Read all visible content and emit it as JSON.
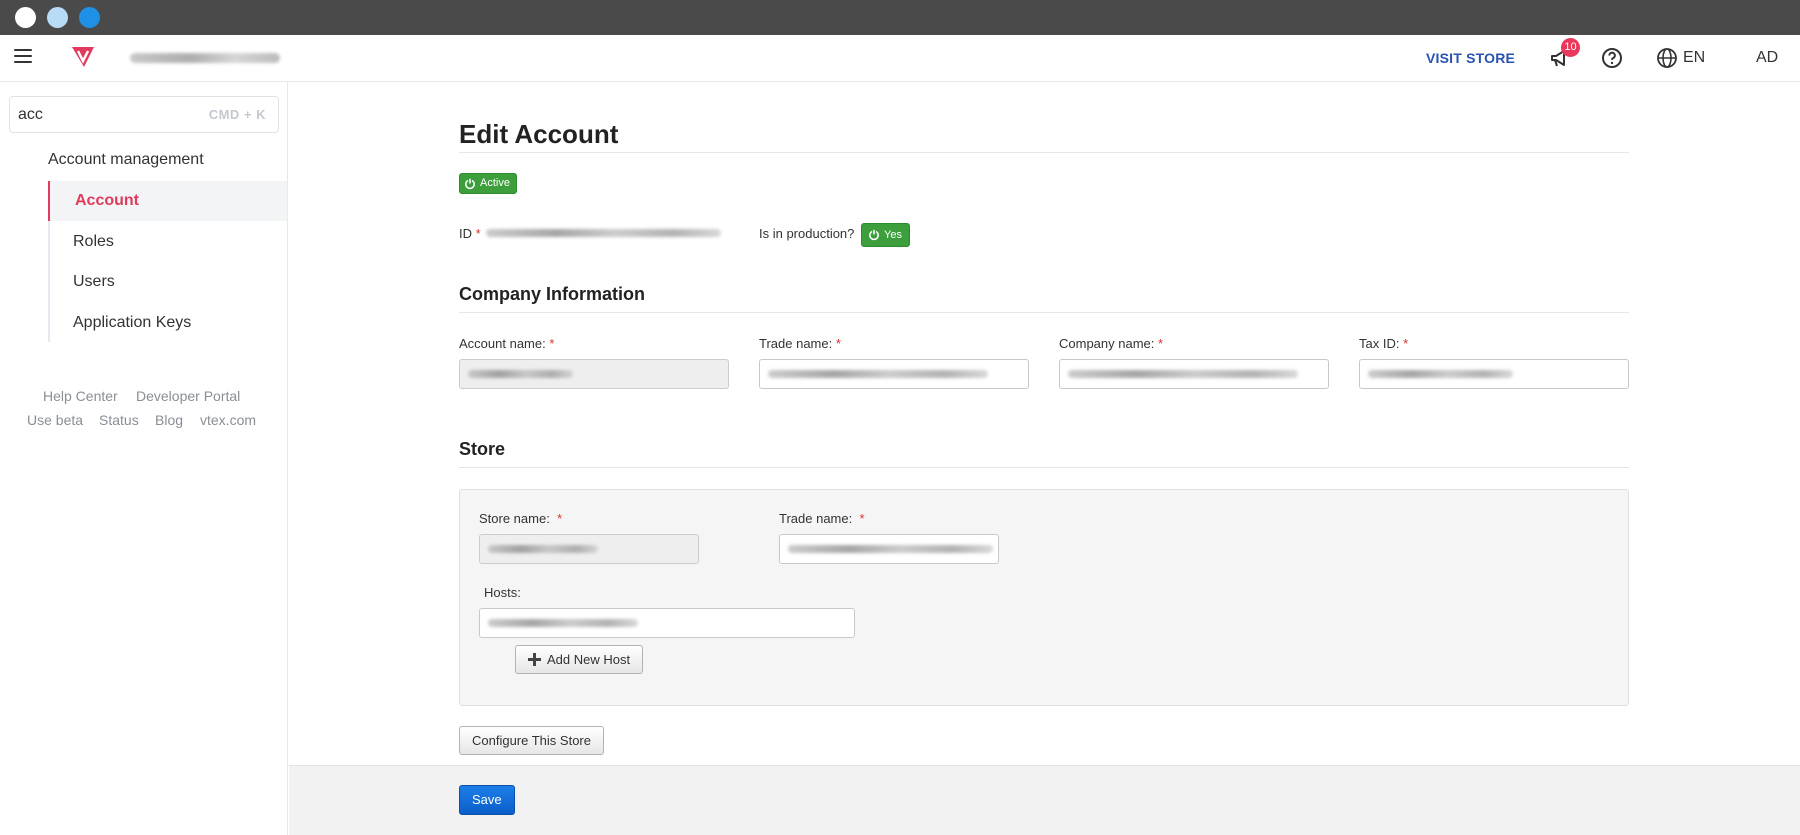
{
  "window": {
    "controls": [
      "close",
      "minimize",
      "zoom"
    ]
  },
  "header": {
    "visit_store": "VISIT STORE",
    "notifications_count": "10",
    "language": "EN",
    "avatar": "AD",
    "colors": {
      "accent": "#2953b2",
      "badge": "#e9385a"
    }
  },
  "sidebar": {
    "search": {
      "value": "acc",
      "shortcut": "CMD + K"
    },
    "group_label": "Account management",
    "items": [
      {
        "label": "Account",
        "active": true
      },
      {
        "label": "Roles"
      },
      {
        "label": "Users"
      },
      {
        "label": "Application Keys"
      }
    ],
    "footer_links": [
      "Help Center",
      "Developer Portal",
      "Use beta",
      "Status",
      "Blog",
      "vtex.com"
    ],
    "colors": {
      "active": "#e13a5c"
    }
  },
  "page": {
    "title": "Edit Account",
    "status_button": "Active",
    "id_label": "ID",
    "required_mark": "*",
    "production_label": "Is in production?",
    "production_button": "Yes"
  },
  "company": {
    "title": "Company Information",
    "account_name_label": "Account name:",
    "trade_name_label": "Trade name:",
    "company_name_label": "Company name:",
    "tax_id_label": "Tax ID:"
  },
  "store": {
    "title": "Store",
    "store_name_label": "Store name:",
    "trade_name_label": "Trade name:",
    "hosts_label": "Hosts:",
    "add_host_button": "Add New Host",
    "configure_button": "Configure This Store"
  },
  "footer": {
    "save_button": "Save"
  }
}
